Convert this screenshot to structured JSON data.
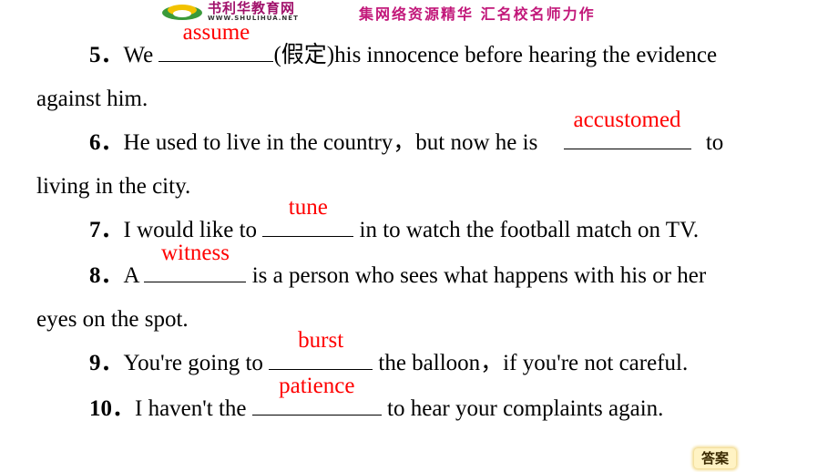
{
  "header": {
    "brand": "书利华教育网",
    "brand_url": "WWW.SHULIHUA.NET",
    "slogan": "集网络资源精华  汇名校名师力作"
  },
  "colors": {
    "answer": "#ff0000",
    "slogan": "#c2187a"
  },
  "questions": [
    {
      "num": "5．",
      "before": "We ",
      "answer": "assume",
      "after": "(假定)his innocence before hearing the evidence",
      "continuation": "against him."
    },
    {
      "num": "6．",
      "before": "He used to live in the country，but now he is ",
      "answer": "accustomed",
      "after": " to",
      "continuation": "living in the city."
    },
    {
      "num": "7．",
      "before": "I would like to ",
      "answer": "tune",
      "after": " in to watch the football match on TV."
    },
    {
      "num": "8．",
      "before": "A ",
      "answer": "witness",
      "after": " is a person who sees what happens with his or her",
      "continuation": "eyes on the spot."
    },
    {
      "num": "9．",
      "before": "You're going to ",
      "answer": "burst",
      "after": " the balloon，if you're not careful."
    },
    {
      "num": "10．",
      "before": "I haven't the ",
      "answer": "patience",
      "after": " to hear your complaints again."
    }
  ],
  "answer_button": {
    "label": "答案"
  }
}
